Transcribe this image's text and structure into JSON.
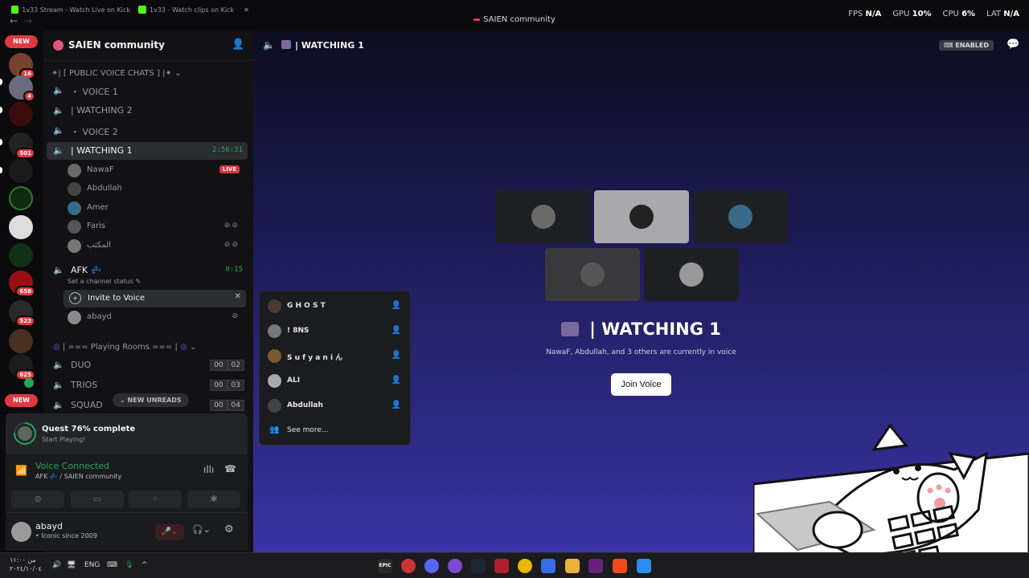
{
  "browser": {
    "tabs": [
      {
        "label": "1v33 Stream - Watch Live on Kick"
      },
      {
        "label": "1v33 - Watch clips on Kick"
      }
    ],
    "window_title": "SAIEN community",
    "perf": {
      "fps_label": "FPS",
      "fps_value": "N/A",
      "gpu_label": "GPU",
      "gpu_value": "10%",
      "cpu_label": "CPU",
      "cpu_value": "6%",
      "lat_label": "LAT",
      "lat_value": "N/A"
    }
  },
  "rail": {
    "new_top": "NEW",
    "new_bottom": "NEW",
    "badges": [
      "16",
      "4",
      "501",
      "658",
      "523",
      "625"
    ]
  },
  "server": {
    "name": "SAIEN community"
  },
  "sidebar": {
    "category_voice": "✴| [ PUBLIC VOICE CHATS ] |✴",
    "channels": [
      {
        "label": "・ VOICE 1"
      },
      {
        "label": "| WATCHING 2"
      },
      {
        "label": "・ VOICE 2"
      },
      {
        "label": "| WATCHING 1",
        "timer": "2:56:31"
      }
    ],
    "watching_users": [
      {
        "name": "NawaF",
        "live": "LIVE"
      },
      {
        "name": "Abdullah"
      },
      {
        "name": "Amer"
      },
      {
        "name": "Faris"
      },
      {
        "name": "المكتب"
      }
    ],
    "afk": {
      "label": "AFK 💤",
      "timer": "0:15",
      "status": "Set a channel status"
    },
    "invite_label": "Invite to Voice",
    "afk_user": "abayd",
    "category_playing": "| === Playing Rooms === |",
    "rooms": [
      {
        "label": "DUO",
        "a": "00",
        "b": "02"
      },
      {
        "label": "TRIOS",
        "a": "00",
        "b": "03"
      },
      {
        "label": "SQUAD",
        "a": "00",
        "b": "04"
      }
    ],
    "new_unreads": "NEW UNREADS"
  },
  "quest": {
    "title": "Quest 76% complete",
    "subtitle": "Start Playing!",
    "progress": 0.76
  },
  "voice_panel": {
    "status": "Voice Connected",
    "location": "AFK 💤 / SAIEN community"
  },
  "userbar": {
    "name": "abayd",
    "status": "• Iconic since 2009"
  },
  "main": {
    "header_title": "| WATCHING 1",
    "enabled_badge": "ENABLED",
    "channel_title": "| WATCHING 1",
    "subtitle": "NawaF, Abdullah, and 3 others are currently in voice",
    "join_label": "Join Voice"
  },
  "invite_popup": {
    "items": [
      {
        "name": "G H O S T"
      },
      {
        "name": "! 8NS"
      },
      {
        "name": "S u f y a n i ん"
      },
      {
        "name": "ALI"
      },
      {
        "name": "Abdullah"
      }
    ],
    "see_more": "See more..."
  },
  "taskbar": {
    "time": "من ١١:٠٠",
    "date": "٢٠٢٤/١٠/٠٤",
    "lang": "ENG",
    "epic_label": "EPIC"
  },
  "colors": {
    "accent": "#5865f2",
    "green": "#23a55a",
    "red": "#da373c"
  }
}
